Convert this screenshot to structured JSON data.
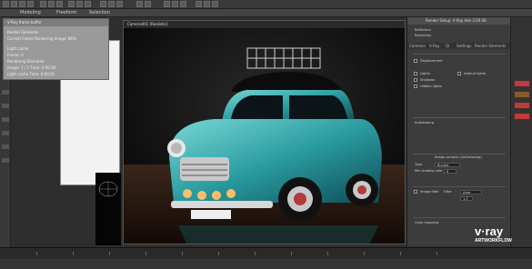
{
  "menu": [
    "Modeling",
    "Freeform",
    "Selection"
  ],
  "viewport": {
    "title": "Camera001 [Realistic]"
  },
  "float_window": {
    "title": "V-Ray frame buffer",
    "rows": [
      "Render Elements",
      "Current Frame    Rendering Image: 86%",
      "Light cache",
      "Frame: 0",
      "Rendering Elements",
      "Image: 1 / 1    Time: 0:00:38",
      "Light cache      Time: 0:00:01"
    ]
  },
  "render_setup": {
    "title": "Render Setup: V-Ray Adv 3.00.08",
    "tabs": [
      "Common",
      "V-Ray",
      "GI",
      "Settings",
      "Render Elements"
    ],
    "rows": [
      "Reflection",
      "Refraction",
      "Displacement",
      "Lights",
      "Shadows",
      "Hidden lights",
      "Default lights",
      "Antialiasing",
      "Image sampler (Antialiasing)",
      "Type",
      "Min shading rate",
      "Image filter",
      "Filter",
      "Color mapping"
    ],
    "values": [
      "Bucket",
      "6",
      "Area",
      "1.5"
    ]
  },
  "vray_logo": {
    "brand": "v·ray",
    "sub": "ARTWORKFLOW"
  },
  "colors": {
    "car": "#2a9ca0",
    "accent": "#ff8a00"
  }
}
